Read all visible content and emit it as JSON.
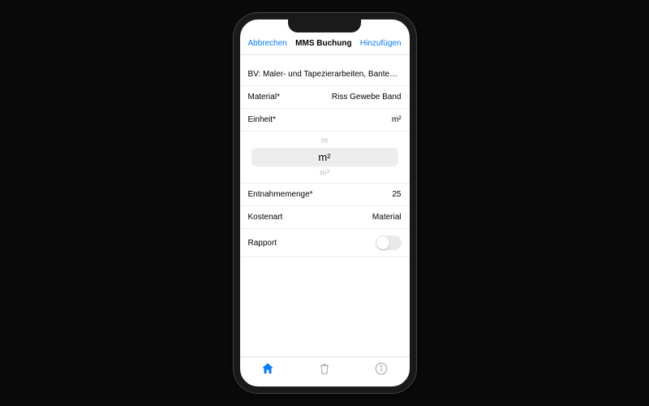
{
  "nav": {
    "cancel": "Abbrechen",
    "title": "MMS Buchung",
    "add": "Hinzufügen"
  },
  "header": {
    "project": "BV: Maler- und Tapezierarbeiten, Bantem, Rü..."
  },
  "rows": {
    "material_label": "Material*",
    "material_value": "Riss Gewebe Band",
    "unit_label": "Einheit*",
    "unit_value": "m²",
    "qty_label": "Entnahmemenge*",
    "qty_value": "25",
    "cost_label": "Kostenart",
    "cost_value": "Material",
    "rapport_label": "Rapport"
  },
  "picker": {
    "prev": "m",
    "selected": "m²",
    "next": "m³"
  },
  "colors": {
    "accent": "#007aff"
  }
}
